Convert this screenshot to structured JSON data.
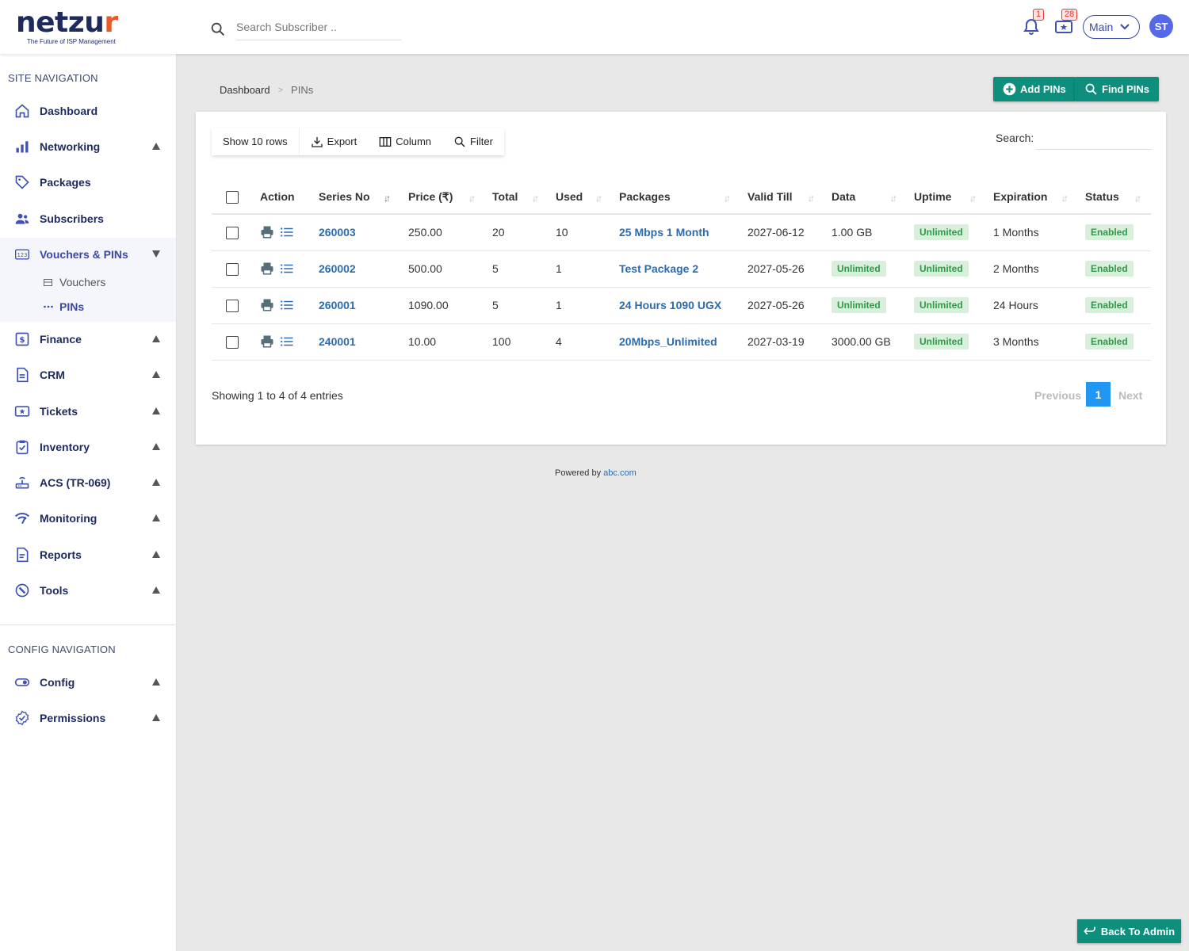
{
  "header": {
    "logo_main": "netzu",
    "logo_accent": "r",
    "logo_tagline": "The Future of ISP Management",
    "search_placeholder": "Search Subscriber ..",
    "notifications_count": "1",
    "tickets_count": "28",
    "branch_select": "Main",
    "user_initials": "ST"
  },
  "sidebar": {
    "site_title": "SITE NAVIGATION",
    "config_title": "CONFIG NAVIGATION",
    "items": [
      {
        "label": "Dashboard",
        "icon": "home-icon"
      },
      {
        "label": "Networking",
        "icon": "bar-chart-icon"
      },
      {
        "label": "Packages",
        "icon": "tag-icon"
      },
      {
        "label": "Subscribers",
        "icon": "users-icon"
      },
      {
        "label": "Vouchers & PINs",
        "icon": "numeric-icon"
      },
      {
        "label": "Finance",
        "icon": "dollar-icon"
      },
      {
        "label": "CRM",
        "icon": "document-icon"
      },
      {
        "label": "Tickets",
        "icon": "ticket-icon"
      },
      {
        "label": "Inventory",
        "icon": "clipboard-check-icon"
      },
      {
        "label": "ACS (TR-069)",
        "icon": "router-icon"
      },
      {
        "label": "Monitoring",
        "icon": "signal-icon"
      },
      {
        "label": "Reports",
        "icon": "report-icon"
      },
      {
        "label": "Tools",
        "icon": "wrench-icon"
      }
    ],
    "sub_items": [
      {
        "label": "Vouchers"
      },
      {
        "label": "PINs"
      }
    ],
    "config_items": [
      {
        "label": "Config",
        "icon": "toggle-icon"
      },
      {
        "label": "Permissions",
        "icon": "verified-badge-icon"
      }
    ]
  },
  "breadcrumb": {
    "home": "Dashboard",
    "separator": ">",
    "current": "PINs"
  },
  "actions": {
    "add_pins": "Add PINs",
    "find_pins": "Find PINs",
    "back_to_admin": "Back To Admin"
  },
  "toolbar": {
    "show_rows": "Show 10 rows",
    "export": "Export",
    "column": "Column",
    "filter": "Filter",
    "search_label": "Search:"
  },
  "table": {
    "columns": [
      "Action",
      "Series No",
      "Price (₹)",
      "Total",
      "Used",
      "Packages",
      "Valid Till",
      "Data",
      "Uptime",
      "Expiration",
      "Status"
    ],
    "rows": [
      {
        "series": "260003",
        "price": "250.00",
        "total": "20",
        "used": "10",
        "package": "25 Mbps 1 Month",
        "valid_till": "2027-06-12",
        "data": "1.00 GB",
        "uptime": "Unlimited",
        "expiration": "1 Months",
        "status": "Enabled"
      },
      {
        "series": "260002",
        "price": "500.00",
        "total": "5",
        "used": "1",
        "package": "Test Package 2",
        "valid_till": "2027-05-26",
        "data": "Unlimited",
        "uptime": "Unlimited",
        "expiration": "2 Months",
        "status": "Enabled"
      },
      {
        "series": "260001",
        "price": "1090.00",
        "total": "5",
        "used": "1",
        "package": "24 Hours 1090 UGX",
        "valid_till": "2027-05-26",
        "data": "Unlimited",
        "uptime": "Unlimited",
        "expiration": "24 Hours",
        "status": "Enabled"
      },
      {
        "series": "240001",
        "price": "10.00",
        "total": "100",
        "used": "4",
        "package": "20Mbps_Unlimited",
        "valid_till": "2027-03-19",
        "data": "3000.00 GB",
        "uptime": "Unlimited",
        "expiration": "3 Months",
        "status": "Enabled"
      }
    ]
  },
  "pagination": {
    "showing": "Showing 1 to 4 of 4 entries",
    "previous": "Previous",
    "page": "1",
    "next": "Next"
  },
  "footer": {
    "powered_by": "Powered by",
    "link": "abc.com"
  },
  "colors": {
    "brand_navy": "#1e2a5e",
    "brand_orange": "#e85a2a",
    "accent_teal": "#0e8f7e",
    "link_blue": "#2b6cb0",
    "active_indigo": "#3949ab",
    "page_blue": "#2196f3",
    "status_green": "#2e9a47"
  }
}
